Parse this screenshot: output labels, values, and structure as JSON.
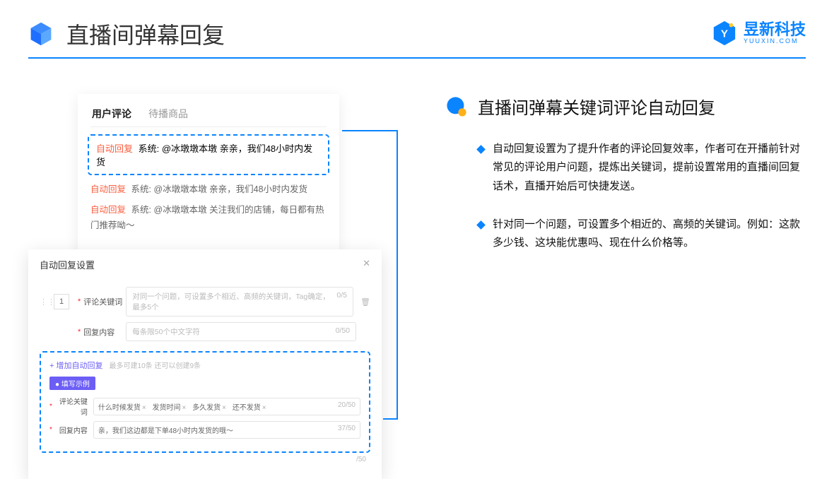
{
  "header": {
    "title": "直播间弹幕回复"
  },
  "brand": {
    "name": "昱新科技",
    "sub": "YUUXIN.COM"
  },
  "right": {
    "title": "直播间弹幕关键词评论自动回复",
    "bullets": [
      "自动回复设置为了提升作者的评论回复效率，作者可在开播前针对常见的评论用户问题，提炼出关键词，提前设置常用的直播间回复话术，直播开始后可快捷发送。",
      "针对同一个问题，可设置多个相近的、高频的关键词。例如：这款多少钱、这块能优惠吗、现在什么价格等。"
    ]
  },
  "comments": {
    "tab_active": "用户评论",
    "tab_other": "待播商品",
    "reply_tag": "自动回复",
    "sys_label": "系统:",
    "highlight": "@冰墩墩本墩 亲亲，我们48小时内发货",
    "line2": "@冰墩墩本墩 亲亲，我们48小时内发货",
    "line3": "@冰墩墩本墩 关注我们的店铺，每日都有热门推荐呦～"
  },
  "settings": {
    "title": "自动回复设置",
    "num": "1",
    "kw_label": "评论关键词",
    "kw_placeholder": "对同一个问题，可设置多个相近、高频的关键词，Tag确定，最多5个",
    "kw_count": "0/5",
    "content_label": "回复内容",
    "content_placeholder": "每条限50个中文字符",
    "content_count": "0/50",
    "add_link": "+ 增加自动回复",
    "add_note": "最多可建10条 还可以创建9条",
    "example_badge": "● 填写示例",
    "ex_kw_label": "评论关键词",
    "ex_kw_chips": [
      "什么时候发货",
      "发货时间",
      "多久发货",
      "还不发货"
    ],
    "ex_kw_count": "20/50",
    "ex_content_label": "回复内容",
    "ex_content_text": "亲，我们这边都是下单48小时内发货的哦～",
    "ex_content_count": "37/50",
    "bottom_count": "/50"
  }
}
